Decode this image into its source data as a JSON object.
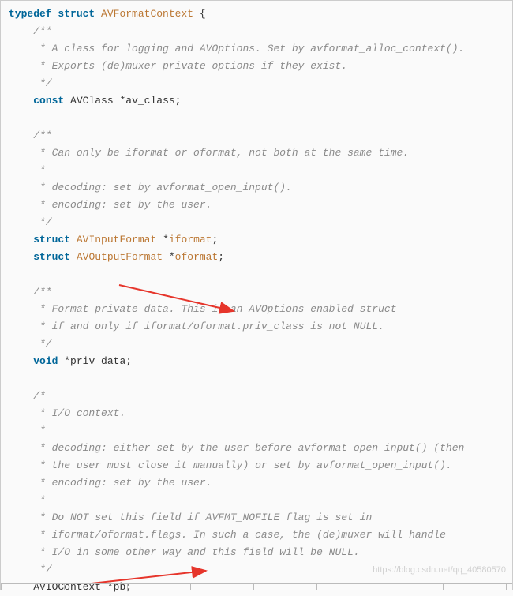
{
  "tokens": {
    "typedef": "typedef",
    "struct": "struct",
    "name_avformatcontext": "AVFormatContext",
    "lbrace": " {",
    "c1_l1": "/**",
    "c1_l2": " * A class for logging and AVOptions. Set by avformat_alloc_context().",
    "c1_l3": " * Exports (de)muxer private options if they exist.",
    "c1_l4": " */",
    "const": "const",
    "avclass": "AVClass",
    "av_class_field": "*av_class;",
    "c2_l1": "/**",
    "c2_l2": " * Can only be iformat or oformat, not both at the same time.",
    "c2_l3": " *",
    "c2_l4": " * decoding: set by avformat_open_input().",
    "c2_l5": " * encoding: set by the user.",
    "c2_l6": " */",
    "avinputformat": "AVInputFormat",
    "iformat": "iformat",
    "avoutputformat": "AVOutputFormat",
    "oformat": "oformat",
    "star": " *",
    "semicolon": ";",
    "c3_l1": "/**",
    "c3_l2": " * Format private data. This is an AVOptions-enabled struct",
    "c3_l3": " * if and only if iformat/oformat.priv_class is not NULL.",
    "c3_l4": " */",
    "void": "void",
    "priv_data": "*priv_data;",
    "c4_l1": "/*",
    "c4_l2": " * I/O context.",
    "c4_l3": " *",
    "c4_l4": " * decoding: either set by the user before avformat_open_input() (then",
    "c4_l5": " * the user must close it manually) or set by avformat_open_input().",
    "c4_l6": " * encoding: set by the user.",
    "c4_l7": " *",
    "c4_l8": " * Do NOT set this field if AVFMT_NOFILE flag is set in",
    "c4_l9": " * iformat/oformat.flags. In such a case, the (de)muxer will handle",
    "c4_l10": " * I/O in some other way and this field will be NULL.",
    "c4_l11": " */",
    "aviocontext": "AVIOContext",
    "pb": "*pb;"
  },
  "indent1": "    ",
  "indent2": "        ",
  "watermark": "https://blog.csdn.net/qq_40580570"
}
